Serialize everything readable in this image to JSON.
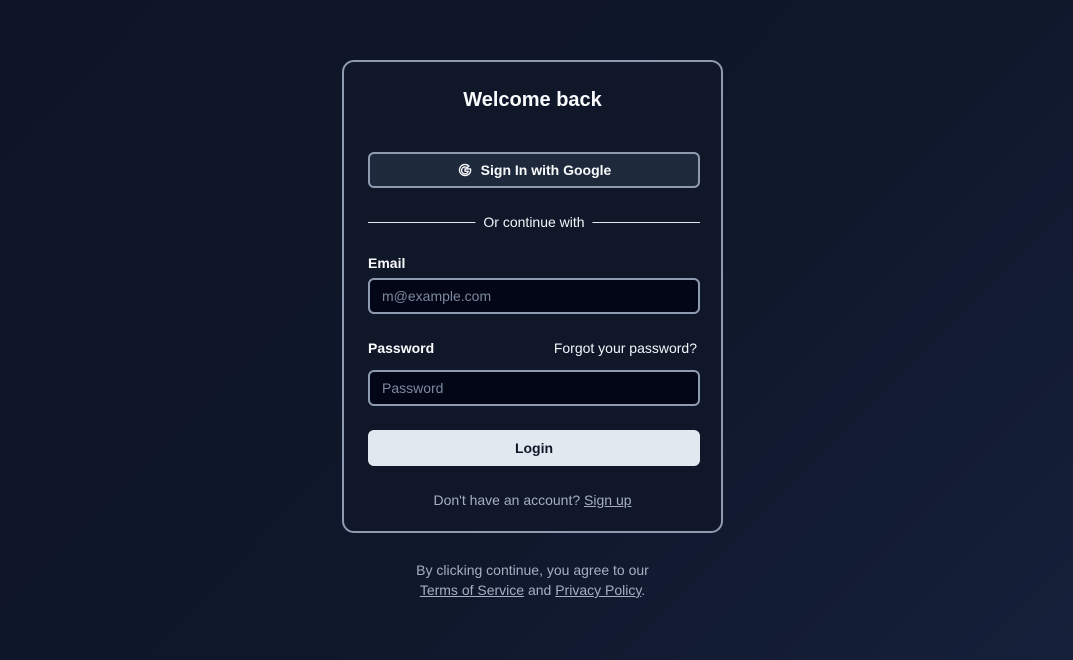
{
  "card": {
    "title": "Welcome back",
    "google_button_label": "Sign In with Google",
    "divider_text": "Or continue with",
    "email": {
      "label": "Email",
      "placeholder": "m@example.com",
      "value": ""
    },
    "password": {
      "label": "Password",
      "placeholder": "Password",
      "value": "",
      "forgot_link": "Forgot your password?"
    },
    "login_button_label": "Login",
    "signup_prompt": "Don't have an account?",
    "signup_link": "Sign up"
  },
  "footer": {
    "prefix": "By clicking continue, you agree to our",
    "terms_link": "Terms of Service",
    "conjunction": "and",
    "privacy_link": "Privacy Policy",
    "suffix": "."
  },
  "colors": {
    "background": "#0f172a",
    "card_border": "#8e9ab0",
    "input_background": "#020617",
    "primary_button": "#e2e8f0"
  },
  "icons": {
    "google": "google-icon"
  }
}
